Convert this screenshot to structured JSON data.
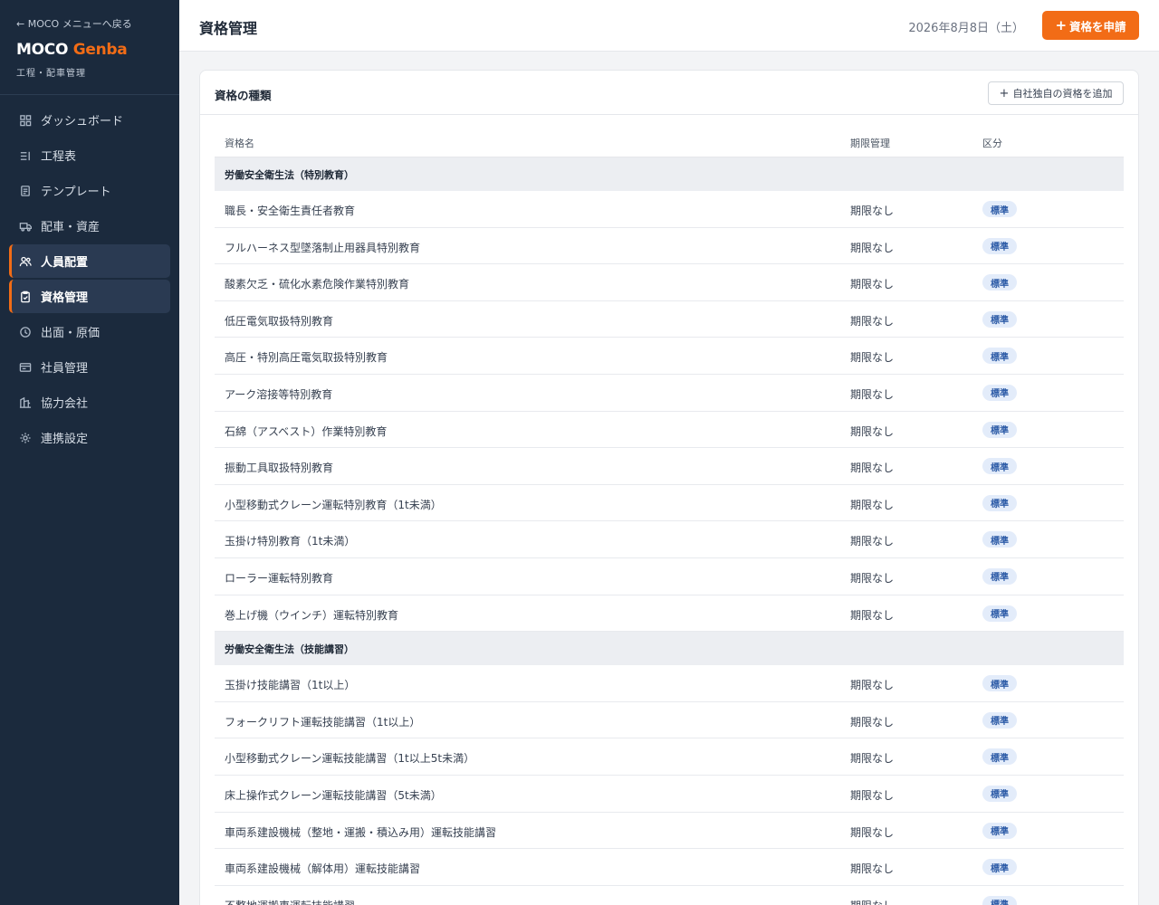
{
  "sidebar": {
    "back_label": "← MOCO メニューへ戻る",
    "brand_main": "MOCO",
    "brand_accent": "Genba",
    "brand_sub": "工程・配車管理",
    "items": [
      {
        "label": "ダッシュボード",
        "icon": "dashboard-icon",
        "active": false
      },
      {
        "label": "工程表",
        "icon": "list-icon",
        "active": false
      },
      {
        "label": "テンプレート",
        "icon": "document-icon",
        "active": false
      },
      {
        "label": "配車・資産",
        "icon": "truck-icon",
        "active": false
      },
      {
        "label": "人員配置",
        "icon": "users-icon",
        "active": true
      },
      {
        "label": "資格管理",
        "icon": "clipboard-icon",
        "active": true
      },
      {
        "label": "出面・原価",
        "icon": "clock-icon",
        "active": false
      },
      {
        "label": "社員管理",
        "icon": "id-card-icon",
        "active": false
      },
      {
        "label": "協力会社",
        "icon": "building-icon",
        "active": false
      },
      {
        "label": "連携設定",
        "icon": "gear-icon",
        "active": false
      }
    ]
  },
  "header": {
    "title": "資格管理",
    "date": "2026年8月8日（土）",
    "apply_label": "資格を申請"
  },
  "card": {
    "title": "資格の種類",
    "add_label": "自社独自の資格を追加"
  },
  "table": {
    "columns": {
      "name": "資格名",
      "expiry": "期限管理",
      "category": "区分"
    },
    "groups": [
      {
        "label": "労働安全衛生法（特別教育）",
        "rows": [
          {
            "name": "職長・安全衛生責任者教育",
            "expiry": "期限なし",
            "category": "標準"
          },
          {
            "name": "フルハーネス型墜落制止用器具特別教育",
            "expiry": "期限なし",
            "category": "標準"
          },
          {
            "name": "酸素欠乏・硫化水素危険作業特別教育",
            "expiry": "期限なし",
            "category": "標準"
          },
          {
            "name": "低圧電気取扱特別教育",
            "expiry": "期限なし",
            "category": "標準"
          },
          {
            "name": "高圧・特別高圧電気取扱特別教育",
            "expiry": "期限なし",
            "category": "標準"
          },
          {
            "name": "アーク溶接等特別教育",
            "expiry": "期限なし",
            "category": "標準"
          },
          {
            "name": "石綿（アスベスト）作業特別教育",
            "expiry": "期限なし",
            "category": "標準"
          },
          {
            "name": "振動工具取扱特別教育",
            "expiry": "期限なし",
            "category": "標準"
          },
          {
            "name": "小型移動式クレーン運転特別教育（1t未満）",
            "expiry": "期限なし",
            "category": "標準"
          },
          {
            "name": "玉掛け特別教育（1t未満）",
            "expiry": "期限なし",
            "category": "標準"
          },
          {
            "name": "ローラー運転特別教育",
            "expiry": "期限なし",
            "category": "標準"
          },
          {
            "name": "巻上げ機（ウインチ）運転特別教育",
            "expiry": "期限なし",
            "category": "標準"
          }
        ]
      },
      {
        "label": "労働安全衛生法（技能講習）",
        "rows": [
          {
            "name": "玉掛け技能講習（1t以上）",
            "expiry": "期限なし",
            "category": "標準"
          },
          {
            "name": "フォークリフト運転技能講習（1t以上）",
            "expiry": "期限なし",
            "category": "標準"
          },
          {
            "name": "小型移動式クレーン運転技能講習（1t以上5t未満）",
            "expiry": "期限なし",
            "category": "標準"
          },
          {
            "name": "床上操作式クレーン運転技能講習（5t未満）",
            "expiry": "期限なし",
            "category": "標準"
          },
          {
            "name": "車両系建設機械（整地・運搬・積込み用）運転技能講習",
            "expiry": "期限なし",
            "category": "標準"
          },
          {
            "name": "車両系建設機械（解体用）運転技能講習",
            "expiry": "期限なし",
            "category": "標準"
          },
          {
            "name": "不整地運搬車運転技能講習",
            "expiry": "期限なし",
            "category": "標準"
          }
        ]
      }
    ]
  },
  "colors": {
    "accent": "#f26c16",
    "sidebar_bg": "#1b2a3d",
    "badge_bg": "#e3ecfa",
    "badge_text": "#2f5da8"
  }
}
